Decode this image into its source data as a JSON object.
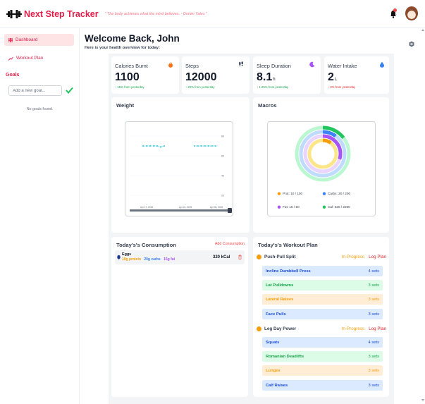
{
  "app": {
    "brand": "Next Step Tracker",
    "quote": "\" The body achieves what the mind believes. - Dorian Yates \""
  },
  "icons": {
    "logo": "dumbbell-icon",
    "notification": "bell-icon",
    "profile": "avatar",
    "settings": "hexagon-icon"
  },
  "sidebar": {
    "items": [
      {
        "label": "Dashboard",
        "icon": "grid-icon",
        "active": true
      },
      {
        "label": "Workout Plan",
        "icon": "trend-icon",
        "active": false
      }
    ],
    "goals_title": "Goals",
    "goal_placeholder": "Add a new goal...",
    "goals_empty": "No goals found."
  },
  "header": {
    "welcome": "Welcome Back, John",
    "subtitle": "Here is your health overview for today:"
  },
  "stats": [
    {
      "title": "Calories Burnt",
      "value": "1100",
      "unit": "",
      "change": "↑ 15% from yesterday",
      "trend": "up",
      "icon": "flame-icon"
    },
    {
      "title": "Steps",
      "value": "12000",
      "unit": "",
      "change": "↑ 20% from yesterday",
      "trend": "up",
      "icon": "footprints-icon"
    },
    {
      "title": "Sleep Duration",
      "value": "8.1",
      "unit": "h",
      "change": "↑ 1.25% from yesterday",
      "trend": "up",
      "icon": "moon-icon"
    },
    {
      "title": "Water Intake",
      "value": "2",
      "unit": "L",
      "change": "↓ 0% from yesterday",
      "trend": "down",
      "icon": "droplet-icon"
    }
  ],
  "weight": {
    "title": "Weight",
    "chart_data": {
      "type": "line",
      "x": [
        "Apr 17, 2025",
        "Apr 24, 2025",
        "Apr 30, 2025"
      ],
      "y_ticks": [
        "80",
        "60",
        "40",
        "20"
      ],
      "series": [
        {
          "values": [
            70,
            70,
            70,
            70,
            70,
            69,
            70,
            70,
            70,
            70,
            70,
            70,
            70,
            70
          ]
        }
      ],
      "ylim": [
        10,
        90
      ],
      "legend": "none"
    }
  },
  "macros": {
    "title": "Macros",
    "chart_data": {
      "type": "pie",
      "categories": [
        "Prot",
        "Carbs",
        "Fat",
        "Cal"
      ],
      "values": [
        10,
        20,
        15,
        320
      ],
      "targets": [
        100,
        200,
        50,
        2200
      ],
      "labels": [
        "Prot: 10 / 100",
        "Carbs: 20 / 200",
        "Fat: 15 / 50",
        "Cal: 320 / 2200"
      ],
      "colors": [
        "#f59e0b",
        "#3b82f6",
        "#a855f7",
        "#22c55e"
      ]
    }
  },
  "consumption": {
    "title": "Today's's Consumption",
    "add_label": "Add Consumption",
    "items": [
      {
        "name": "Eggs",
        "protein": "10g protein",
        "carbs": "20g carbs",
        "fat": "15g fat",
        "kcal": "320 kCal",
        "icon": "egg-icon",
        "delete_icon": "trash-icon"
      }
    ]
  },
  "workout": {
    "title": "Today's's Workout Plan",
    "plans": [
      {
        "name": "Push-Pull Split",
        "status": "In-Progress",
        "action": "Log Plan",
        "exercises": [
          {
            "name": "Incline Dumbbell Press",
            "sets": "4 sets",
            "color": "blue"
          },
          {
            "name": "Lat Pulldowns",
            "sets": "3 sets",
            "color": "green"
          },
          {
            "name": "Lateral Raises",
            "sets": "3 sets",
            "color": "orange"
          },
          {
            "name": "Face Pulls",
            "sets": "3 sets",
            "color": "blue"
          }
        ]
      },
      {
        "name": "Leg Day Power",
        "status": "In-Progress",
        "action": "Log Plan",
        "exercises": [
          {
            "name": "Squats",
            "sets": "4 sets",
            "color": "blue"
          },
          {
            "name": "Romanian Deadlifts",
            "sets": "3 sets",
            "color": "green"
          },
          {
            "name": "Lunges",
            "sets": "3 sets",
            "color": "orange"
          },
          {
            "name": "Calf Raises",
            "sets": "3 sets",
            "color": "blue"
          }
        ]
      }
    ]
  },
  "colors": {
    "brand": "#e11d48",
    "accent": "#f59e0b"
  }
}
